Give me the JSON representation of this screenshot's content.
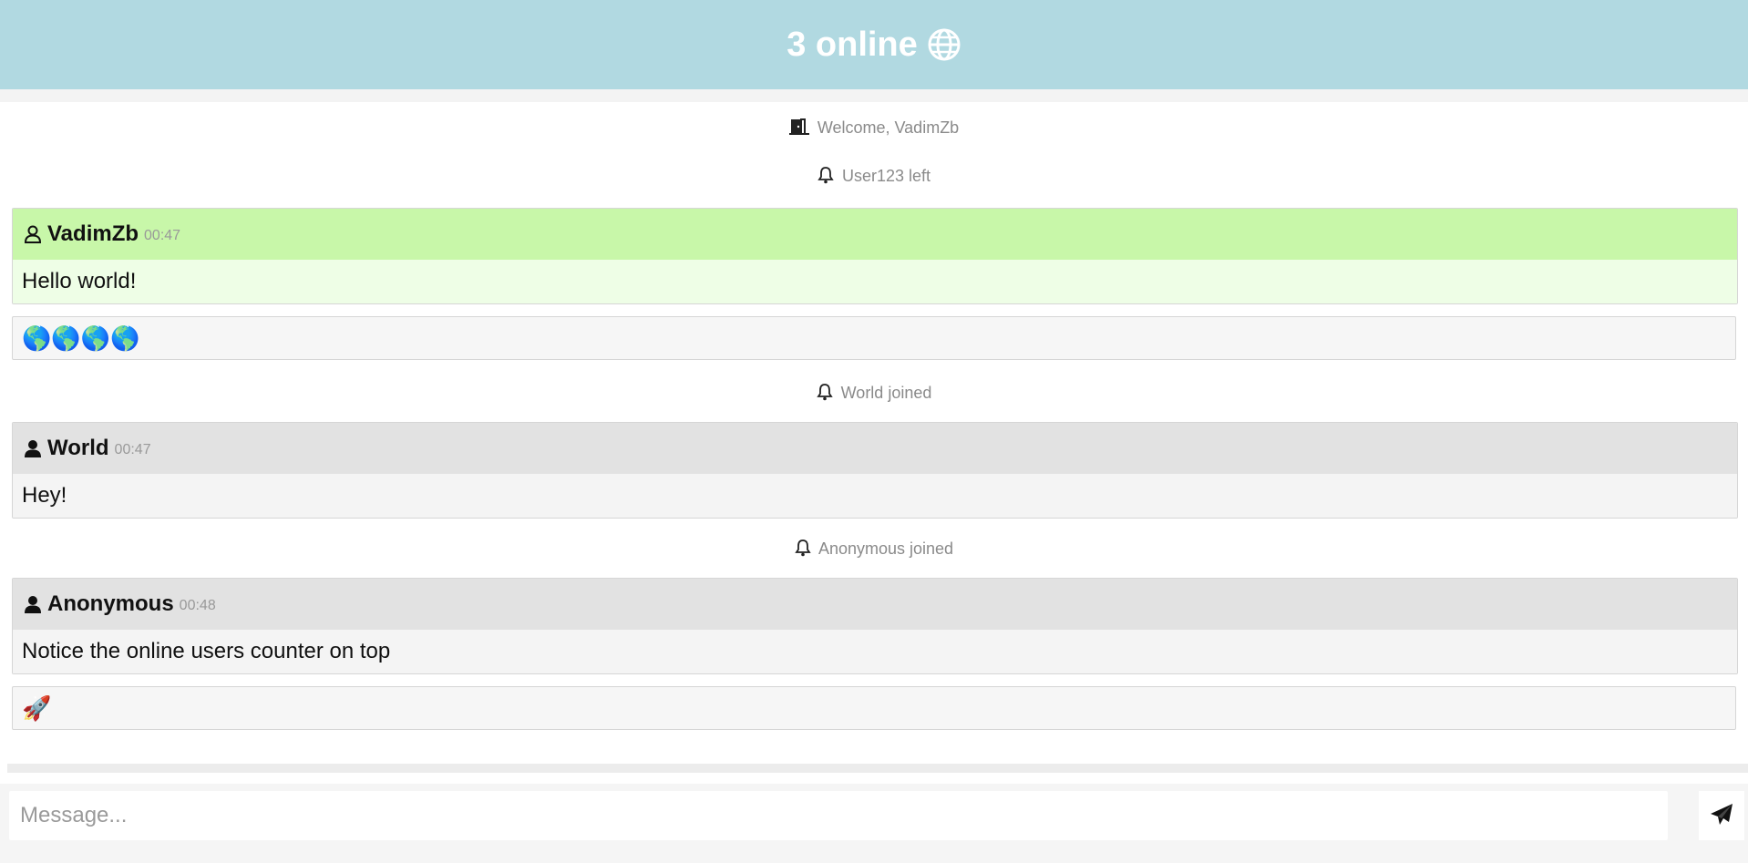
{
  "header": {
    "title": "3 online",
    "icon": "globe-icon",
    "background": "#b1d9e1"
  },
  "feed": {
    "notices": [
      {
        "icon": "door-icon",
        "text": "Welcome, VadimZb"
      },
      {
        "icon": "bell-icon",
        "text": "User123 left"
      },
      {
        "icon": "bell-icon",
        "text": "World joined"
      },
      {
        "icon": "bell-icon",
        "text": "Anonymous joined"
      }
    ],
    "messages": [
      {
        "user": "VadimZb",
        "time": "00:47",
        "text": "Hello world!",
        "own": true,
        "extra": "🌎🌎🌎🌎"
      },
      {
        "user": "World",
        "time": "00:47",
        "text": "Hey!",
        "own": false
      },
      {
        "user": "Anonymous",
        "time": "00:48",
        "text": "Notice the online users counter on top",
        "own": false,
        "extra": "🚀"
      }
    ]
  },
  "composer": {
    "placeholder": "Message...",
    "send_icon": "send-icon"
  },
  "colors": {
    "own_head": "#c8f7a9",
    "own_body": "#eefee6",
    "other_head": "#e2e2e2",
    "other_body": "#f4f4f4"
  }
}
